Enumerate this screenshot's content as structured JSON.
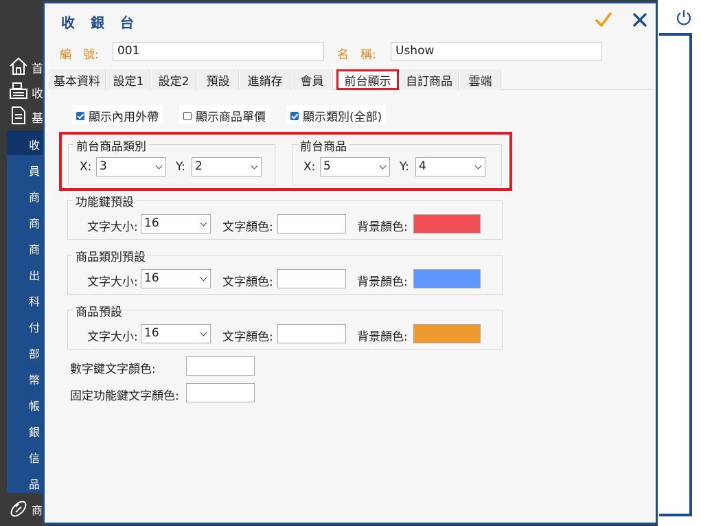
{
  "left_nav": {
    "top_items": [
      {
        "icon": "home-icon",
        "label": "首"
      },
      {
        "icon": "cash-register-icon",
        "label": "收"
      },
      {
        "icon": "document-icon",
        "label": "基"
      }
    ],
    "items": [
      "收",
      "員",
      "商",
      "商",
      "商",
      "出",
      "科",
      "付",
      "部",
      "幣",
      "帳",
      "銀",
      "信",
      "品"
    ],
    "selected_index": 0,
    "bottom_item": {
      "icon": "bread-icon",
      "label": "商"
    }
  },
  "dialog": {
    "title": "收 銀 台",
    "code_label": "編　號:",
    "code_value": "001",
    "name_label": "名　稱:",
    "name_value": "Ushow",
    "tabs": [
      "基本資料",
      "設定1",
      "設定2",
      "預設",
      "進銷存",
      "會員",
      "前台顯示",
      "自訂商品",
      "雲端"
    ],
    "active_tab_index": 6,
    "checkboxes": [
      {
        "label": "顯示內用外帶",
        "checked": true
      },
      {
        "label": "顯示商品單價",
        "checked": false
      },
      {
        "label": "顯示類別(全部)",
        "checked": true
      }
    ],
    "grid_category": {
      "title": "前台商品類別",
      "x_label": "X:",
      "x_value": "3",
      "y_label": "Y:",
      "y_value": "2"
    },
    "grid_product": {
      "title": "前台商品",
      "x_label": "X:",
      "x_value": "5",
      "y_label": "Y:",
      "y_value": "4"
    },
    "presets": [
      {
        "title": "功能鍵預設",
        "size_label": "文字大小:",
        "size_value": "16",
        "text_color_label": "文字顏色:",
        "text_color": "#ffffff",
        "bg_color_label": "背景顏色:",
        "bg_color": "#ef4f55"
      },
      {
        "title": "商品類別預設",
        "size_label": "文字大小:",
        "size_value": "16",
        "text_color_label": "文字顏色:",
        "text_color": "#ffffff",
        "bg_color_label": "背景顏色:",
        "bg_color": "#6096ff"
      },
      {
        "title": "商品預設",
        "size_label": "文字大小:",
        "size_value": "16",
        "text_color_label": "文字顏色:",
        "text_color": "#ffffff",
        "bg_color_label": "背景顏色:",
        "bg_color": "#f0992e"
      }
    ],
    "numpad_color_label": "數字鍵文字顏色:",
    "numpad_color": "#ffffff",
    "fixed_fn_color_label": "固定功能鍵文字顏色:",
    "fixed_fn_color": "#ffffff"
  },
  "colors": {
    "accent": "#1e4d8c",
    "label_orange": "#e6871e",
    "highlight_red": "#e21b23",
    "confirm": "#f39c12"
  }
}
